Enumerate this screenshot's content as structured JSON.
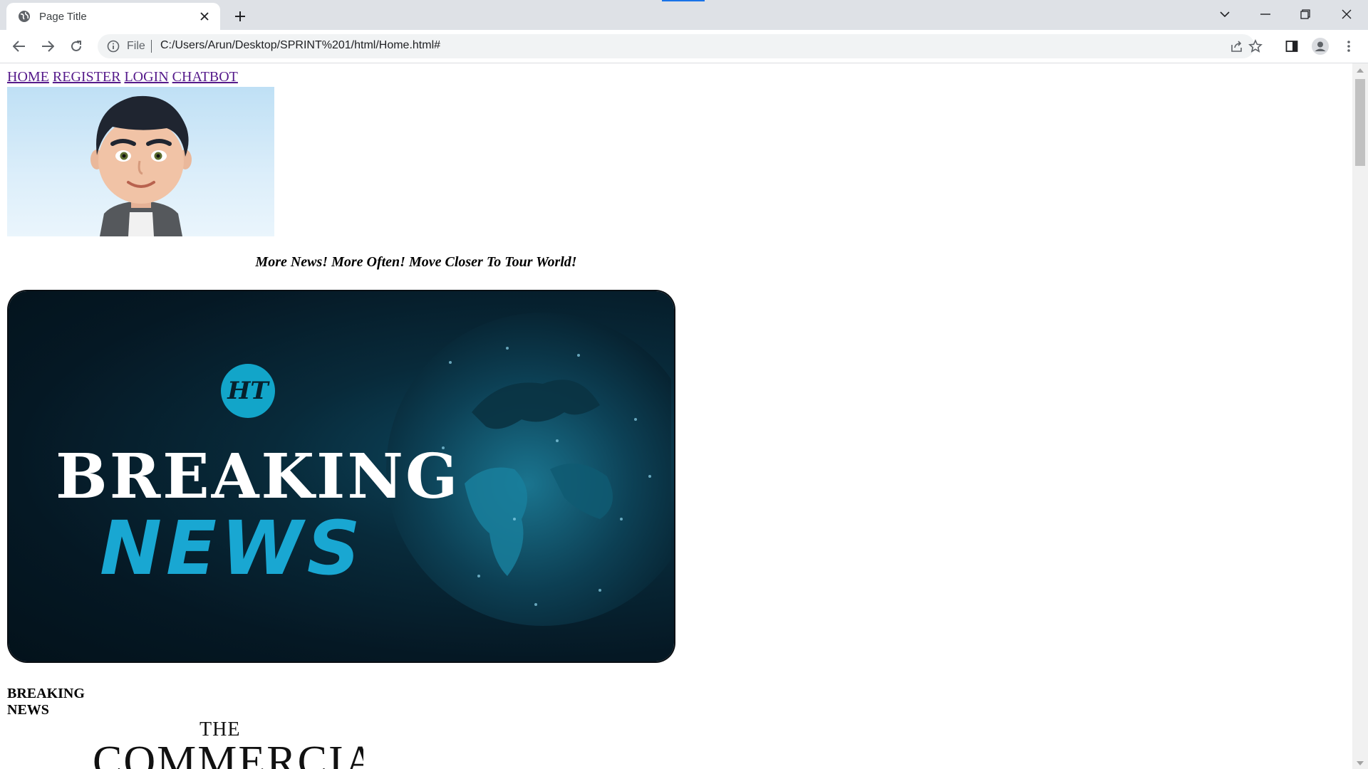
{
  "browser": {
    "tab_title": "Page Title",
    "address_scheme": "File",
    "address_url": "C:/Users/Arun/Desktop/SPRINT%201/html/Home.html#"
  },
  "page": {
    "nav": [
      {
        "label": "HOME"
      },
      {
        "label": "REGISTER"
      },
      {
        "label": "LOGIN"
      },
      {
        "label": "CHATBOT"
      }
    ],
    "tagline": "More News! More Often! Move Closer To Tour World!",
    "banner": {
      "badge_text": "HT",
      "line1": "BREAKING",
      "line2": "NEWS"
    },
    "section_heading": "BREAKING NEWS",
    "logo": {
      "the": "THE",
      "name": "COMMERCIAL"
    }
  },
  "colors": {
    "link": "#551a8b",
    "banner_accent": "#19a7d2",
    "chrome_bg": "#dee1e6"
  }
}
